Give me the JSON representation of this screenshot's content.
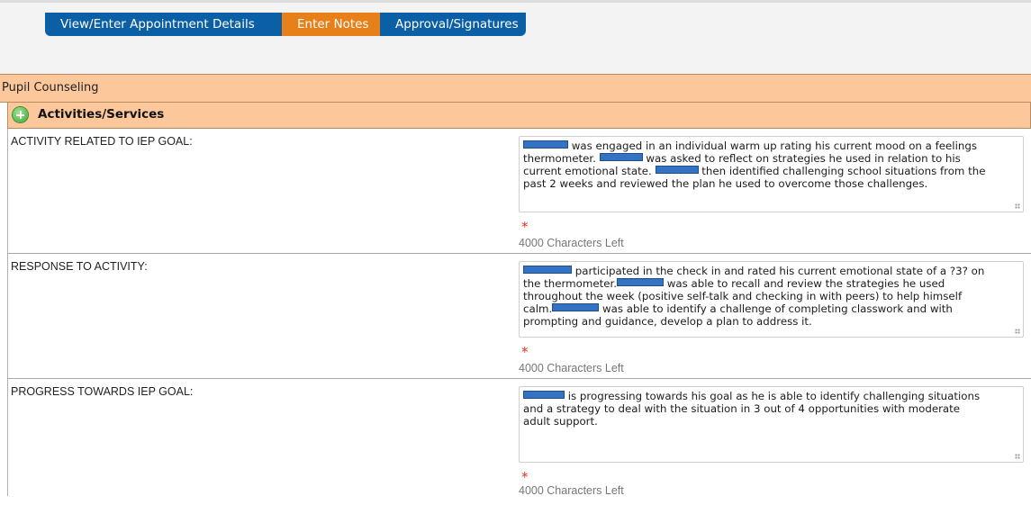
{
  "tabs": [
    {
      "label": "View/Enter Appointment Details",
      "active": false
    },
    {
      "label": "Enter Notes",
      "active": true
    },
    {
      "label": "Approval/Signatures",
      "active": false
    }
  ],
  "section": {
    "title": "Pupil Counseling"
  },
  "subsection": {
    "title": "Activities/Services"
  },
  "required_marker": "*",
  "rows": [
    {
      "label": "ACTIVITY RELATED TO IEP GOAL:",
      "chars_left": "4000 Characters Left",
      "text": [
        " was engaged in an individual warm up rating his current mood on a feelings",
        "thermometer. ",
        " was asked to reflect on strategies he used in relation to his",
        "current emotional state. ",
        " then identified challenging school situations from the",
        "past 2 weeks and reviewed the plan he used to overcome those challenges."
      ]
    },
    {
      "label": "RESPONSE TO ACTIVITY:",
      "chars_left": "4000 Characters Left",
      "text": [
        " participated in the check in and rated his current emotional state of a ?3? on",
        "the thermometer.",
        " was able to recall and review the strategies he used",
        "throughout the week  (positive self-talk and checking in with peers) to help himself",
        "calm.",
        " was able to identify a challenge of completing classwork and with",
        "prompting and guidance, develop a plan to address it."
      ]
    },
    {
      "label": "PROGRESS TOWARDS IEP GOAL:",
      "chars_left": "4000 Characters Left",
      "text": [
        " is progressing towards his goal as he is able to identify challenging situations",
        "and a strategy to deal with the situation in 3 out of 4 opportunities with moderate",
        "adult support."
      ]
    }
  ],
  "colors": {
    "tab_blue": "#0b5fa5",
    "tab_active_orange": "#e8801a",
    "section_peach": "#fcc79a",
    "redaction_blue": "#3473c4"
  }
}
